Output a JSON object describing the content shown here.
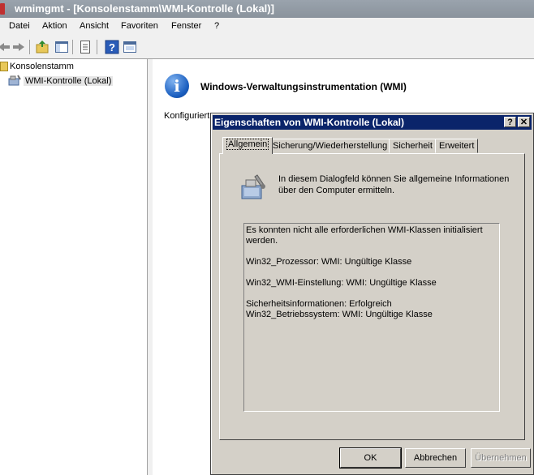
{
  "app": {
    "title": "wmimgmt - [Konsolenstamm\\WMI-Kontrolle (Lokal)]"
  },
  "menu": [
    "Datei",
    "Aktion",
    "Ansicht",
    "Favoriten",
    "Fenster",
    "?"
  ],
  "toolbar": {
    "icons": [
      "back-arrow-icon",
      "forward-arrow-icon",
      "up-folder-icon",
      "show-hide-tree-icon",
      "properties-icon",
      "help-icon",
      "console-icon"
    ]
  },
  "tree": {
    "root": "Konsolenstamm",
    "child": "WMI-Kontrolle (Lokal)"
  },
  "content": {
    "heading": "Windows-Verwaltungsinstrumentation (WMI)",
    "configured_prefix": "Konfiguriert"
  },
  "dialog": {
    "title": "Eigenschaften von WMI-Kontrolle (Lokal)",
    "help_btn": "?",
    "close_btn": "✕",
    "tabs": [
      "Allgemein",
      "Sicherung/Wiederherstellung",
      "Sicherheit",
      "Erweitert"
    ],
    "intro": "In diesem Dialogfeld können Sie allgemeine Informationen über den Computer ermitteln.",
    "status_lines": [
      "Es konnten nicht alle erforderlichen WMI-Klassen initialisiert",
      "werden.",
      "",
      "Win32_Prozessor: WMI: Ungültige Klasse",
      "",
      "Win32_WMI-Einstellung: WMI: Ungültige Klasse",
      "",
      "Sicherheitsinformationen: Erfolgreich",
      "Win32_Betriebssystem: WMI: Ungültige Klasse"
    ],
    "buttons": {
      "ok": "OK",
      "cancel": "Abbrechen",
      "apply": "Übernehmen"
    }
  }
}
